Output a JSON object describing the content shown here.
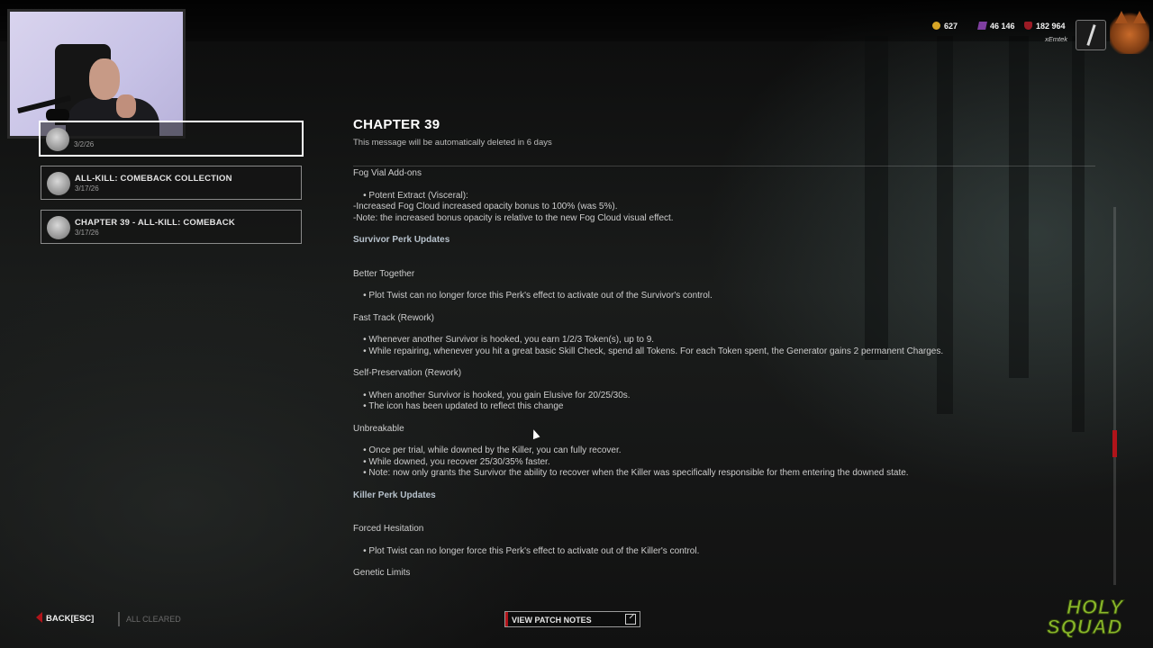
{
  "currencies": {
    "bloodpoints": "627",
    "auric_cells": "46 146",
    "iridescent_shards": "182 964",
    "username": "xEmtek"
  },
  "messages": [
    {
      "title": "",
      "date": "3/2/26",
      "selected": true
    },
    {
      "title": "ALL-KILL: COMEBACK COLLECTION",
      "date": "3/17/26",
      "selected": false
    },
    {
      "title": "CHAPTER 39 - ALL-KILL: COMEBACK",
      "date": "3/17/26",
      "selected": false
    }
  ],
  "content": {
    "title": "CHAPTER 39",
    "subtitle": "This message will be automatically deleted in 6 days",
    "lines": [
      {
        "text": "Fog Vial Add-ons",
        "heading": false,
        "gap": 0
      },
      {
        "text": "    • Potent Extract (Visceral):",
        "heading": false,
        "gap": 12
      },
      {
        "text": "-Increased Fog Cloud increased opacity bonus to 100% (was 5%).",
        "heading": false,
        "gap": 0
      },
      {
        "text": "-Note: the increased bonus opacity is relative to the new Fog Cloud visual effect.",
        "heading": false,
        "gap": 0
      },
      {
        "text": "Survivor Perk Updates",
        "heading": true,
        "gap": 12
      },
      {
        "text": "Better Together",
        "heading": false,
        "gap": 25
      },
      {
        "text": "    • Plot Twist can no longer force this Perk's effect to activate out of the Survivor's control.",
        "heading": false,
        "gap": 12
      },
      {
        "text": "Fast Track (Rework)",
        "heading": false,
        "gap": 12
      },
      {
        "text": "    • Whenever another Survivor is hooked, you earn 1/2/3 Token(s), up to 9.",
        "heading": false,
        "gap": 12
      },
      {
        "text": "    • While repairing, whenever you hit a great basic Skill Check, spend all Tokens. For each Token spent, the Generator gains 2 permanent Charges.",
        "heading": false,
        "gap": 0
      },
      {
        "text": "Self-Preservation (Rework)",
        "heading": false,
        "gap": 12
      },
      {
        "text": "    • When another Survivor is hooked, you gain Elusive for 20/25/30s.",
        "heading": false,
        "gap": 12
      },
      {
        "text": "    • The icon has been updated to reflect this change",
        "heading": false,
        "gap": 0
      },
      {
        "text": "Unbreakable",
        "heading": false,
        "gap": 12
      },
      {
        "text": "    • Once per trial, while downed by the Killer, you can fully recover.",
        "heading": false,
        "gap": 12
      },
      {
        "text": "    • While downed, you recover 25/30/35% faster.",
        "heading": false,
        "gap": 0
      },
      {
        "text": "    • Note: now only grants the Survivor the ability to recover when the Killer was specifically responsible for them entering the downed state.",
        "heading": false,
        "gap": 0
      },
      {
        "text": "Killer Perk Updates",
        "heading": true,
        "gap": 12
      },
      {
        "text": "Forced Hesitation",
        "heading": false,
        "gap": 25
      },
      {
        "text": "    • Plot Twist can no longer force this Perk's effect to activate out of the Killer's control.",
        "heading": false,
        "gap": 12
      },
      {
        "text": "Genetic Limits",
        "heading": false,
        "gap": 12
      }
    ]
  },
  "footer": {
    "back_label": "BACK",
    "back_key": "[ESC]",
    "all_cleared": "ALL CLEARED",
    "patch_notes": "VIEW PATCH NOTES",
    "logo_line1": "HOLY",
    "logo_line2": "SQUAD"
  },
  "colors": {
    "accent_red": "#b0141a",
    "heading_blue": "#b7c2cc"
  }
}
